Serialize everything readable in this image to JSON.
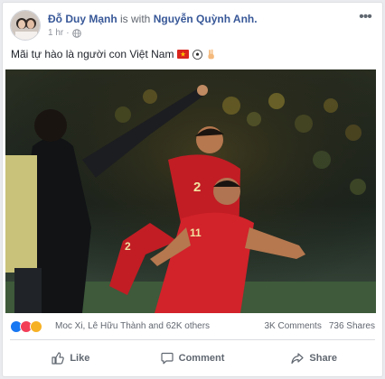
{
  "post": {
    "author": "Đỗ Duy Mạnh",
    "with_text": "is with",
    "tagged": "Nguyễn Quỳnh Anh.",
    "time": "1 hr",
    "time_sep": "·",
    "more": "•••",
    "caption": "Mãi tự hào là người con Việt Nam"
  },
  "photo": {
    "jersey_numbers": [
      "2",
      "11",
      "2"
    ]
  },
  "reactions": {
    "names": "Moc Xi, Lê Hữu Thành and 62K others",
    "comments": "3K Comments",
    "shares": "736 Shares",
    "colors": {
      "like": "#1877f2",
      "love": "#f33e58",
      "haha": "#f7b125"
    }
  },
  "actions": {
    "like": "Like",
    "comment": "Comment",
    "share": "Share"
  }
}
